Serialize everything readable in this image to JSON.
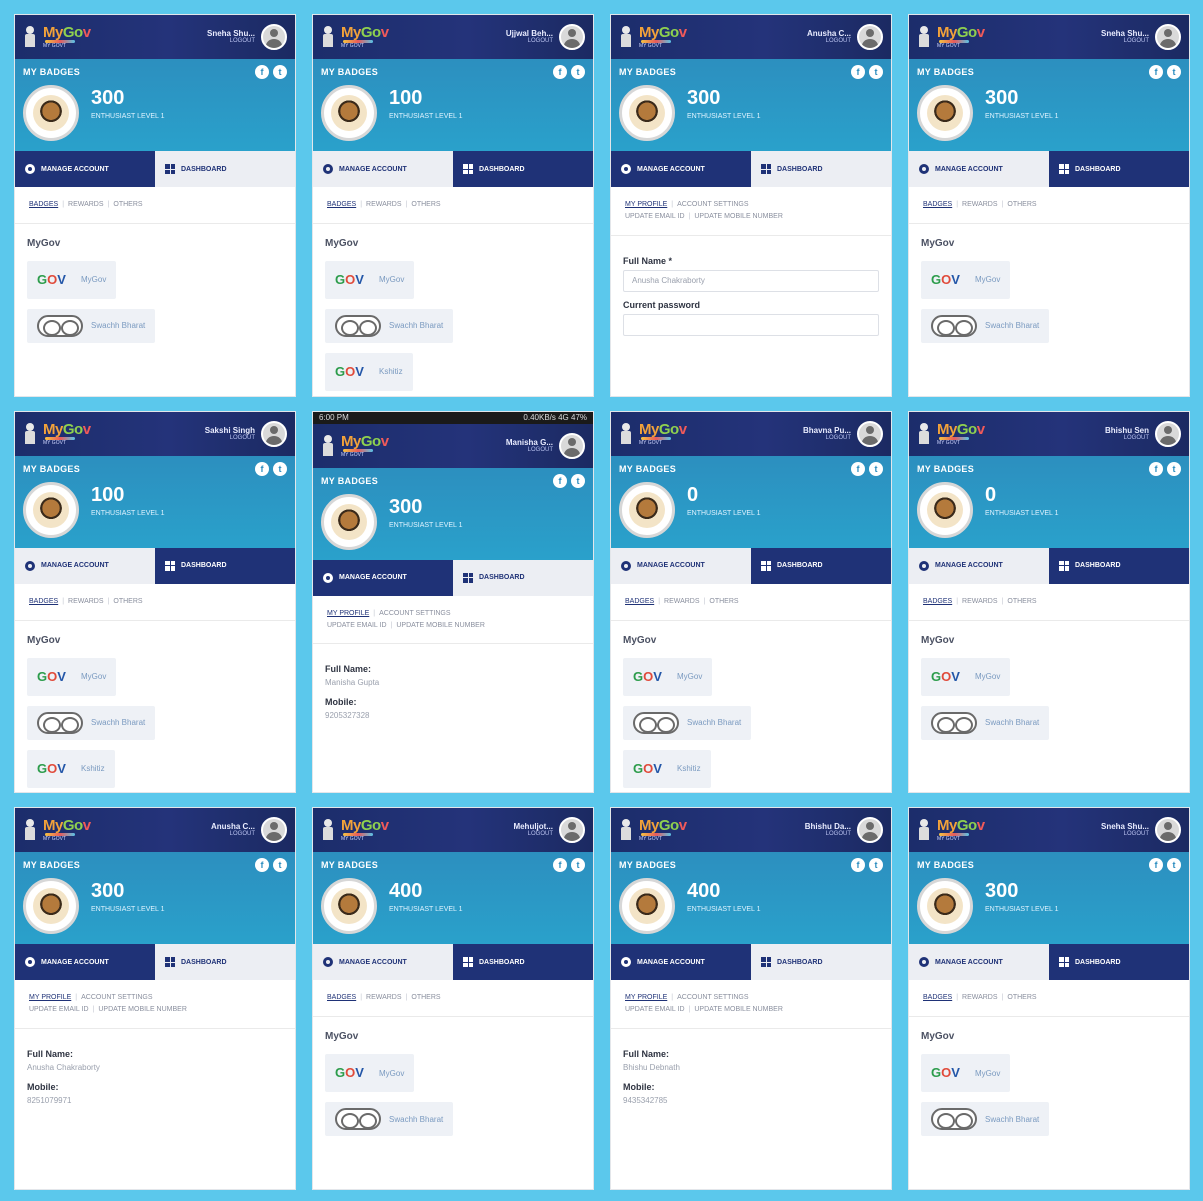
{
  "common": {
    "my_badges": "MY BADGES",
    "manage_account": "MANAGE ACCOUNT",
    "dashboard": "DASHBOARD",
    "logout": "LOGOUT",
    "logo_text": "MyGov",
    "logo_sub": "MY GOVT",
    "facebook_glyph": "f",
    "twitter_glyph": "t",
    "subtabs_badges": [
      "BADGES",
      "REWARDS",
      "OTHERS"
    ],
    "subtabs_profile": [
      "MY PROFILE",
      "ACCOUNT SETTINGS",
      "UPDATE EMAIL ID",
      "UPDATE MOBILE NUMBER"
    ],
    "section_mygov": "MyGov",
    "app_mygov": "MyGov",
    "app_swachh": "Swachh Bharat",
    "app_third": "Kshitiz",
    "field_full_name": "Full Name:",
    "field_full_name_req": "Full Name *",
    "field_current_password": "Current password",
    "field_mobile": "Mobile:",
    "icons": {
      "facebook": "facebook-icon",
      "twitter": "twitter-icon",
      "gear": "gear-icon",
      "dashboard": "dashboard-grid-icon",
      "emblem": "emblem-icon",
      "avatar": "user-avatar-icon",
      "badge": "badge-medal-icon"
    }
  },
  "colors": {
    "background": "#5bc8ec",
    "topbar": "#1f2e6e",
    "badge_panel": "#2a98c6",
    "active_tab": "#1f3277",
    "inactive_tab": "#eceef3"
  },
  "panels": [
    {
      "user": "Sneha Shu...",
      "points": "300",
      "level": "ENTHUSIAST LEVEL 1",
      "active": "manage",
      "view": "badges",
      "apps": 2
    },
    {
      "user": "Ujjwal Beh...",
      "points": "100",
      "level": "ENTHUSIAST LEVEL 1",
      "active": "dashboard",
      "view": "badges",
      "apps": 4
    },
    {
      "user": "Anusha C...",
      "points": "300",
      "level": "ENTHUSIAST LEVEL 1",
      "active": "manage",
      "view": "password",
      "full_name": "Anusha Chakraborty",
      "apps": 0
    },
    {
      "user": "Sneha Shu...",
      "points": "300",
      "level": "ENTHUSIAST LEVEL 1",
      "active": "dashboard",
      "view": "badges",
      "apps": 2
    },
    {
      "user": "Sakshi Singh",
      "points": "100",
      "level": "ENTHUSIAST LEVEL 1",
      "active": "dashboard",
      "view": "badges",
      "apps": 3
    },
    {
      "user": "Manisha G...",
      "points": "300",
      "level": "ENTHUSIAST LEVEL 1",
      "active": "manage",
      "view": "profile",
      "full_name": "Manisha Gupta",
      "mobile": "9205327328",
      "apps": 0,
      "status": true
    },
    {
      "user": "Bhavna Pu...",
      "points": "0",
      "level": "ENTHUSIAST LEVEL 1",
      "active": "dashboard",
      "view": "badges",
      "apps": 3
    },
    {
      "user": "Bhishu Sen",
      "points": "0",
      "level": "ENTHUSIAST LEVEL 1",
      "active": "dashboard",
      "view": "badges",
      "apps": 2
    },
    {
      "user": "Anusha C...",
      "points": "300",
      "level": "ENTHUSIAST LEVEL 1",
      "active": "manage",
      "view": "profile",
      "full_name": "Anusha Chakraborty",
      "mobile": "8251079971",
      "apps": 0
    },
    {
      "user": "Mehuljot...",
      "points": "400",
      "level": "ENTHUSIAST LEVEL 1",
      "active": "dashboard",
      "view": "badges",
      "apps": 2
    },
    {
      "user": "Bhishu Da...",
      "points": "400",
      "level": "ENTHUSIAST LEVEL 1",
      "active": "manage",
      "view": "profile",
      "full_name": "Bhishu Debnath",
      "mobile": "9435342785",
      "apps": 0
    },
    {
      "user": "Sneha Shu...",
      "points": "300",
      "level": "ENTHUSIAST LEVEL 1",
      "active": "dashboard",
      "view": "badges",
      "apps": 2
    }
  ],
  "status": {
    "time": "6:00 PM",
    "right": "0.40KB/s  4G  47%"
  }
}
